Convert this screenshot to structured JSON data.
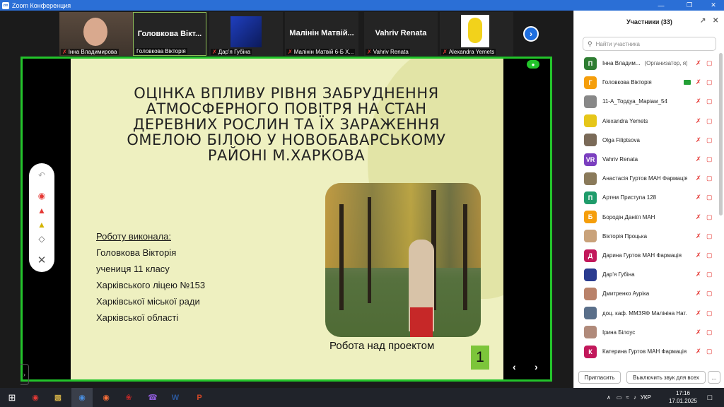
{
  "window": {
    "title": "Zoom Конференция",
    "app_icon": "zm"
  },
  "thumbnails": [
    {
      "name": "Інна Владимирова",
      "big_name": ""
    },
    {
      "name": "Головкова Вікторія",
      "big_name": "Головкова Вікт..."
    },
    {
      "name": "Дар'я Губіна",
      "big_name": ""
    },
    {
      "name": "Малінін Матвій 6-Б Х...",
      "big_name": "Малінін Матвій..."
    },
    {
      "name": "Vahriv Renata",
      "big_name": "Vahriv Renata"
    },
    {
      "name": "Alexandra Yemets",
      "big_name": ""
    }
  ],
  "slide": {
    "title": "ОЦІНКА ВПЛИВУ РІВНЯ ЗАБРУДНЕННЯ АТМОСФЕРНОГО ПОВІТРЯ НА СТАН ДЕРЕВНИХ РОСЛИН ТА ЇХ ЗАРАЖЕННЯ ОМЕЛОЮ БІЛОЮ У НОВОБАВАРСЬКОМУ РАЙОНІ М.ХАРКОВА",
    "author_label": "Роботу виконала:",
    "author_lines": [
      "Головкова Вікторія",
      "учениця 11 класу",
      "Харківського ліцею №153",
      "Харківської міської ради",
      "Харківської області"
    ],
    "photo_caption": "Робота над проектом",
    "number": "1"
  },
  "participants_panel": {
    "title": "Участники (33)",
    "search_placeholder": "Найти участника",
    "invite_label": "Пригласить",
    "mute_all_label": "Выключить звук для всех",
    "more_label": "..."
  },
  "participants": [
    {
      "initial": "П",
      "name": "Інна Владим...",
      "role": "(Организатор, я)",
      "color": "#2e7d32"
    },
    {
      "initial": "Г",
      "name": "Головкова Вікторія",
      "role": "",
      "color": "#f59e0b"
    },
    {
      "initial": "",
      "name": "11-А_Тордуа_Маріам_54",
      "role": "",
      "color": "#888888"
    },
    {
      "initial": "",
      "name": "Alexandra Yemets",
      "role": "",
      "color": "#e6c619"
    },
    {
      "initial": "",
      "name": "Olga Filiptsova",
      "role": "",
      "color": "#7a6a58"
    },
    {
      "initial": "VR",
      "name": "Vahriv Renata",
      "role": "",
      "color": "#7b3fbf"
    },
    {
      "initial": "",
      "name": "Анастасія Гуртов МАН Фармація",
      "role": "",
      "color": "#8a7a5a"
    },
    {
      "initial": "П",
      "name": "Артем Приступа 128",
      "role": "",
      "color": "#1f9c6b"
    },
    {
      "initial": "Б",
      "name": "Бородін Даніїл МАН",
      "role": "",
      "color": "#f59e0b"
    },
    {
      "initial": "",
      "name": "Вікторія Процька",
      "role": "",
      "color": "#c9a27a"
    },
    {
      "initial": "Д",
      "name": "Дарина Гуртов МАН Фармація",
      "role": "",
      "color": "#c2185b"
    },
    {
      "initial": "",
      "name": "Дар'я Губіна",
      "role": "",
      "color": "#2a3b8f"
    },
    {
      "initial": "",
      "name": "Дмитренко Ауріка",
      "role": "",
      "color": "#b9826a"
    },
    {
      "initial": "",
      "name": "доц. каф. ММЗЯФ Малініна Нат...",
      "role": "",
      "color": "#5a6f8a"
    },
    {
      "initial": "",
      "name": "Ірина Білоус",
      "role": "",
      "color": "#b08a7a"
    },
    {
      "initial": "К",
      "name": "Катерина Гуртов МАН Фармація",
      "role": "",
      "color": "#c2185b"
    }
  ],
  "taskbar": {
    "lang": "УКР",
    "time": "17:16",
    "date": "17.01.2025"
  }
}
